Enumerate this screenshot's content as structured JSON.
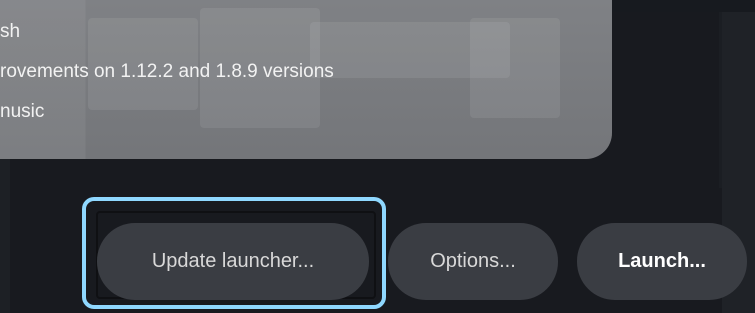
{
  "news": {
    "lines": [
      "sh",
      "rovements on 1.12.2 and 1.8.9 versions",
      "nusic"
    ]
  },
  "buttons": {
    "update_launcher": "Update launcher...",
    "options": "Options...",
    "launch": "Launch..."
  },
  "colors": {
    "background": "#181a1f",
    "card": "#7a7c80",
    "button": "#3a3d43",
    "focus_ring": "#8fd8ff"
  }
}
